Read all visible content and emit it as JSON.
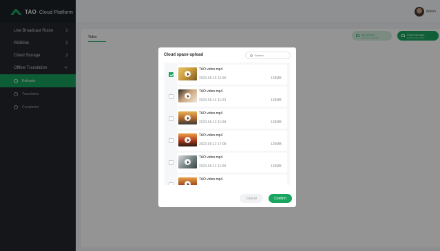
{
  "app": {
    "brand_tao": "TAO",
    "brand_platform": "Cloud Platform",
    "user_name": "Admin"
  },
  "sidebar": {
    "items": [
      {
        "label": "Live Broadcast Room",
        "expanded": false
      },
      {
        "label": "RGBlink",
        "expanded": false
      },
      {
        "label": "Cloud Storage",
        "expanded": false
      },
      {
        "label": "Offline Translation",
        "expanded": true
      }
    ],
    "subitems": [
      {
        "label": "Estimate",
        "active": true
      },
      {
        "label": "Translation",
        "active": false
      },
      {
        "label": "Completed",
        "active": false
      }
    ]
  },
  "main": {
    "tab_label": "Video",
    "device_button": {
      "label": "My Device",
      "sub": "Get from local disk"
    },
    "cloud_button": {
      "label": "Cloud Storage",
      "sub": "Get from the cloud"
    }
  },
  "modal": {
    "title": "Cloud space upload",
    "search_placeholder": "Search...",
    "files": [
      {
        "name": "TAO video.mp4",
        "date": "2023-06-15 12:36",
        "size": "128MB",
        "checked": true
      },
      {
        "name": "TAO video.mp4",
        "date": "2023-06-14 11:23",
        "size": "128MB",
        "checked": false
      },
      {
        "name": "TAO video.mp4",
        "date": "2023-06-13 11:08",
        "size": "128MB",
        "checked": false
      },
      {
        "name": "TAO video.mp4",
        "date": "2023-06-12 17:08",
        "size": "128MB",
        "checked": false
      },
      {
        "name": "TAO video.mp4",
        "date": "2023-06-12 11:08",
        "size": "128MB",
        "checked": false
      },
      {
        "name": "TAO video.mp4",
        "date": "",
        "size": "",
        "checked": false
      }
    ],
    "cancel_label": "Cancel",
    "confirm_label": "Confirm"
  },
  "colors": {
    "accent": "#1aa660",
    "sidebar_bg": "#23272d",
    "sidebar_active": "#17a05d"
  }
}
